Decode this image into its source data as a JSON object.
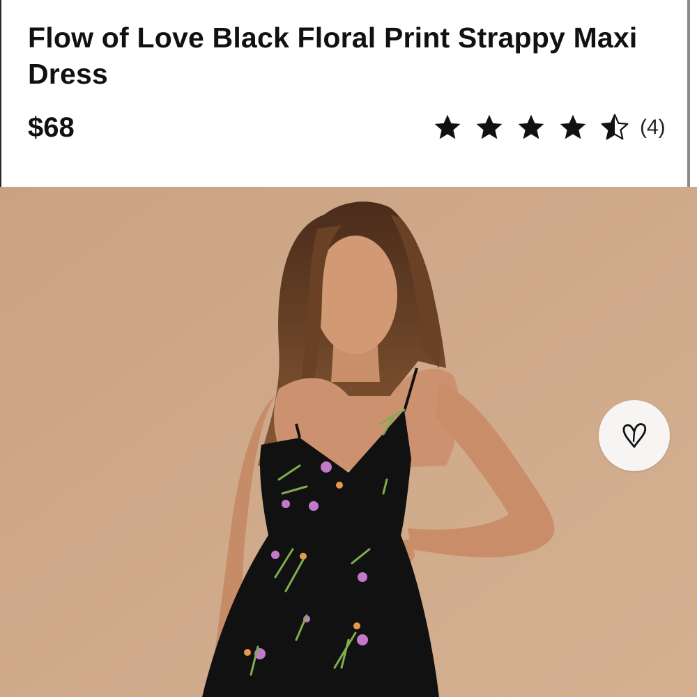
{
  "product": {
    "title": "Flow of Love Black Floral Print Strappy Maxi Dress",
    "price": "$68",
    "rating": {
      "value": 4.5,
      "max": 5,
      "review_count_label": "(4)"
    },
    "image_background_color": "#cfa989",
    "dress_color": "#111111"
  },
  "actions": {
    "favorite_icon": "heart-outline-icon"
  }
}
